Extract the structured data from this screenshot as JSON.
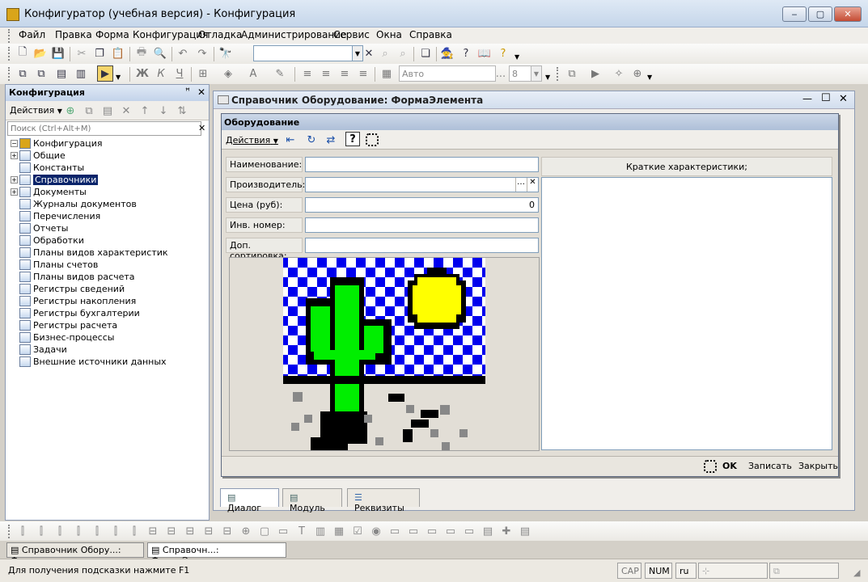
{
  "window": {
    "title": "Конфигуратор (учебная версия) - Конфигурация",
    "controls": {
      "minimize": "‒",
      "maximize": "▢",
      "close": "✕"
    }
  },
  "menu": [
    "Файл",
    "Правка",
    "Форма",
    "Конфигурация",
    "Отладка",
    "Администрирование",
    "Сервис",
    "Окна",
    "Справка"
  ],
  "toolbar": {
    "search_value": "",
    "font_value": "Авто",
    "font_size_value": "8",
    "ellipsis": "..."
  },
  "config_panel": {
    "title": "Конфигурация",
    "pin": "ꟸ",
    "close": "✕",
    "actions_label": "Действия",
    "search_placeholder": "Поиск (Ctrl+Alt+M)",
    "tree": [
      {
        "label": "Конфигурация",
        "level": 0,
        "expander": "−",
        "selected": false
      },
      {
        "label": "Общие",
        "level": 1,
        "expander": "+",
        "selected": false
      },
      {
        "label": "Константы",
        "level": 1,
        "expander": "",
        "selected": false
      },
      {
        "label": "Справочники",
        "level": 1,
        "expander": "+",
        "selected": true
      },
      {
        "label": "Документы",
        "level": 1,
        "expander": "+",
        "selected": false
      },
      {
        "label": "Журналы документов",
        "level": 1,
        "expander": "",
        "selected": false
      },
      {
        "label": "Перечисления",
        "level": 1,
        "expander": "",
        "selected": false
      },
      {
        "label": "Отчеты",
        "level": 1,
        "expander": "",
        "selected": false
      },
      {
        "label": "Обработки",
        "level": 1,
        "expander": "",
        "selected": false
      },
      {
        "label": "Планы видов характеристик",
        "level": 1,
        "expander": "",
        "selected": false
      },
      {
        "label": "Планы счетов",
        "level": 1,
        "expander": "",
        "selected": false
      },
      {
        "label": "Планы видов расчета",
        "level": 1,
        "expander": "",
        "selected": false
      },
      {
        "label": "Регистры сведений",
        "level": 1,
        "expander": "",
        "selected": false
      },
      {
        "label": "Регистры накопления",
        "level": 1,
        "expander": "",
        "selected": false
      },
      {
        "label": "Регистры бухгалтерии",
        "level": 1,
        "expander": "",
        "selected": false
      },
      {
        "label": "Регистры расчета",
        "level": 1,
        "expander": "",
        "selected": false
      },
      {
        "label": "Бизнес-процессы",
        "level": 1,
        "expander": "",
        "selected": false
      },
      {
        "label": "Задачи",
        "level": 1,
        "expander": "",
        "selected": false
      },
      {
        "label": "Внешние источники данных",
        "level": 1,
        "expander": "",
        "selected": false
      }
    ]
  },
  "mdi": {
    "title": "Справочник Оборудование: ФормаЭлемента",
    "controls": {
      "minimize": "—",
      "maximize": "☐",
      "close": "✕"
    }
  },
  "form": {
    "title": "Оборудование",
    "actions_label": "Действия",
    "fields": {
      "name_label": "Наименование:",
      "name_value": "",
      "maker_label": "Производитель:",
      "maker_value": "",
      "price_label": "Цена (руб):",
      "price_value": "0",
      "inv_label": "Инв. номер:",
      "inv_value": "",
      "sort_label": "Доп. сортировка:",
      "sort_value": ""
    },
    "desc_header": "Краткие характеристики;",
    "buttons": {
      "ok": "OK",
      "save": "Записать",
      "close": "Закрыть"
    },
    "tabs": [
      "Диалог",
      "Модуль",
      "Реквизиты"
    ]
  },
  "taskbar": [
    "Справочник Обору...: Форма",
    "Справочн...: ФормаЭлемента"
  ],
  "status": {
    "hint": "Для получения подсказки нажмите F1",
    "cap": "CAP",
    "num": "NUM",
    "lang": "ru"
  },
  "colors": {
    "selection": "#0a246a",
    "sky_blue": "#0000ee",
    "sun": "#ffff00",
    "cactus": "#00ee00"
  }
}
